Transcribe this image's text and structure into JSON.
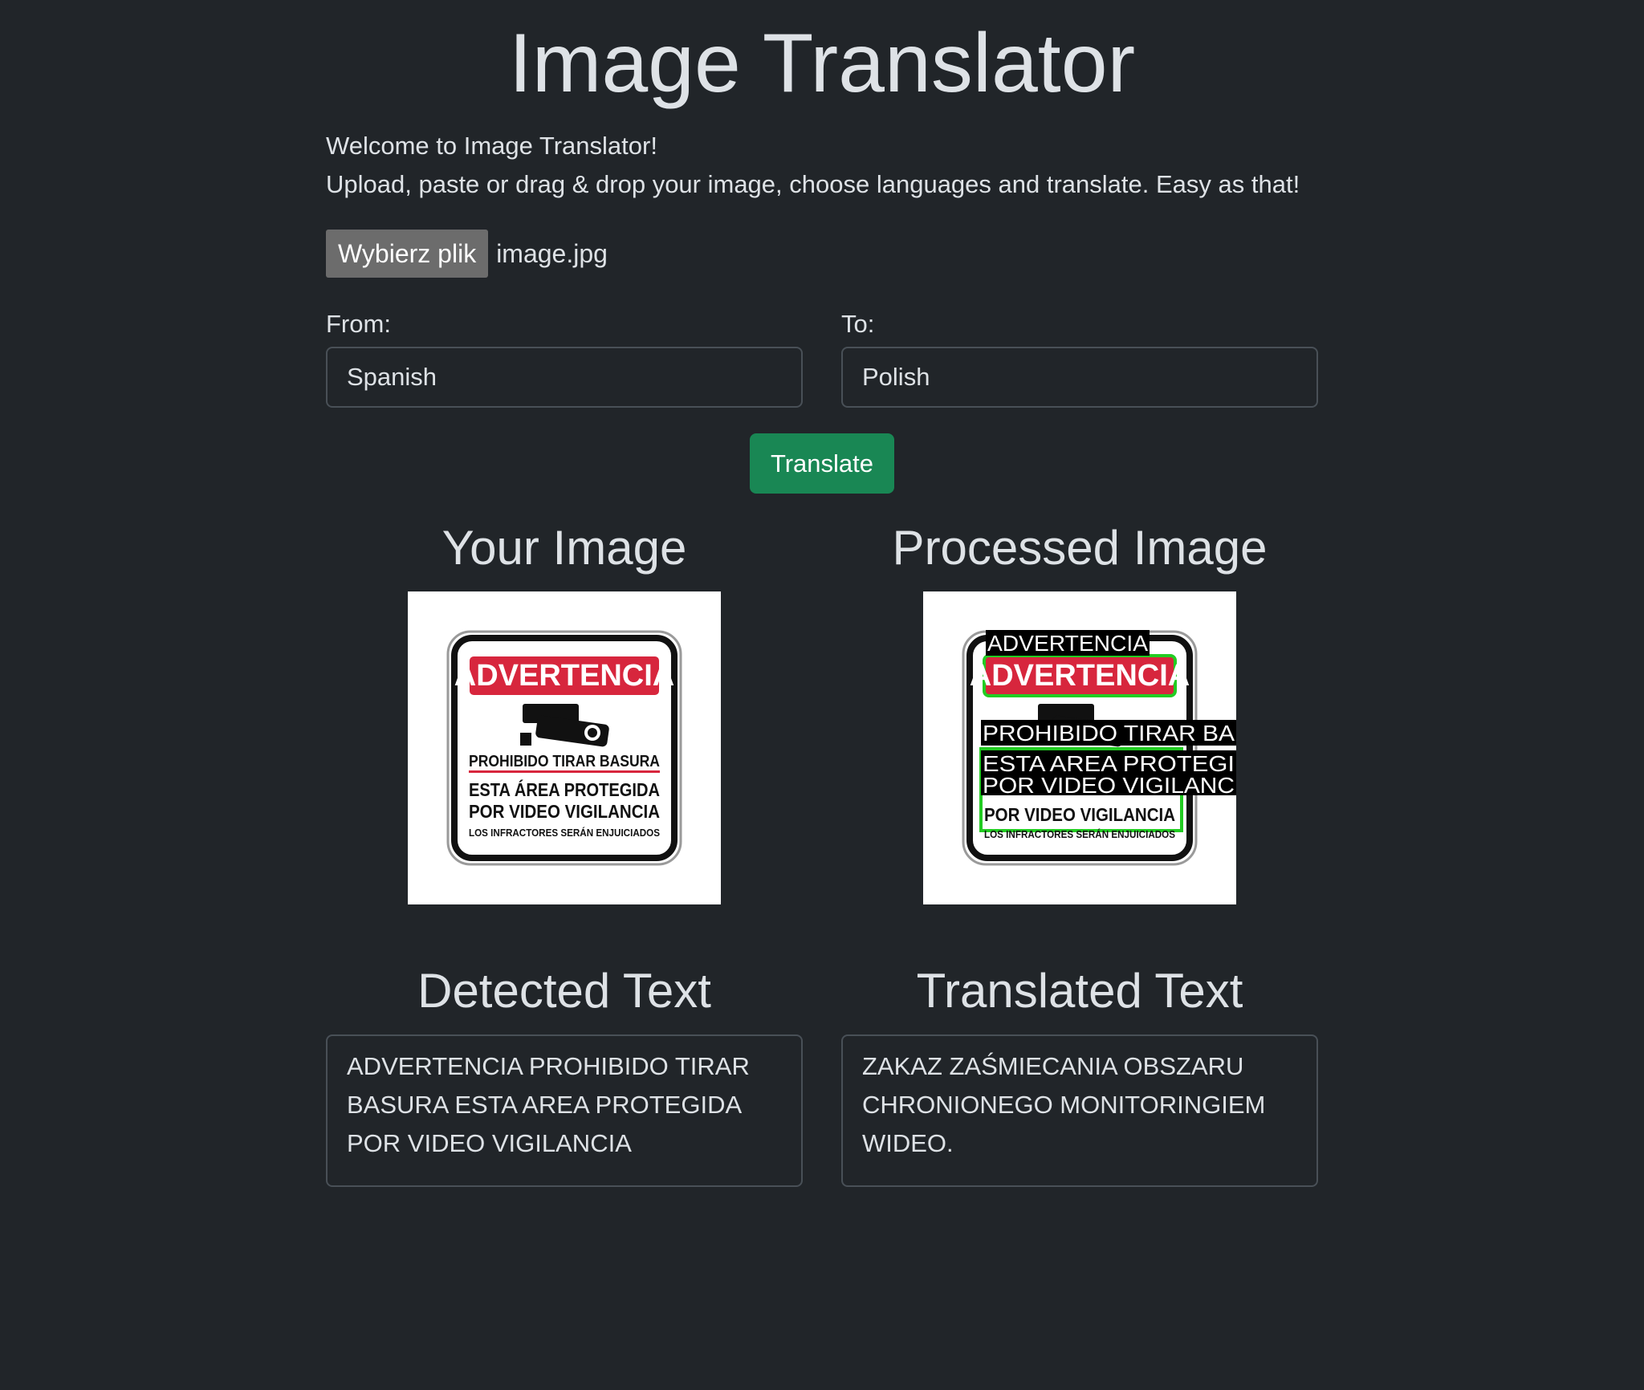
{
  "app": {
    "title": "Image Translator"
  },
  "intro": {
    "welcome": "Welcome to Image Translator!",
    "instructions": "Upload, paste or drag & drop your image, choose languages and translate. Easy as that!"
  },
  "file": {
    "button_label": "Wybierz plik",
    "file_name": "image.jpg"
  },
  "languages": {
    "from_label": "From:",
    "from_value": "Spanish",
    "to_label": "To:",
    "to_value": "Polish"
  },
  "translate_label": "Translate",
  "images": {
    "original_title": "Your Image",
    "processed_title": "Processed Image",
    "sign": {
      "header": "ADVERTENCIA",
      "line1": "PROHIBIDO TIRAR BASURA",
      "line2": "ESTA ÁREA PROTEGIDA",
      "line3": "POR VIDEO VIGILANCIA",
      "line4": "LOS INFRACTORES SERÁN ENJUICIADOS"
    },
    "overlays": {
      "o1": "ADVERTENCIA",
      "o2": "PROHIBIDO TIRAR BA",
      "o3": "ESTA AREA PROTEGI",
      "o4": "POR VIDEO VIGILANC"
    }
  },
  "detected": {
    "title": "Detected Text",
    "text": "ADVERTENCIA PROHIBIDO TIRAR BASURA ESTA AREA PROTEGIDA POR VIDEO VIGILANCIA"
  },
  "translated": {
    "title": "Translated Text",
    "text": "ZAKAZ ZAŚMIECANIA OBSZARU CHRONIONEGO MONITORINGIEM WIDEO."
  },
  "colors": {
    "background": "#212529",
    "text": "#dee2e6",
    "accent_green": "#198754",
    "sign_red": "#d7263d",
    "detection_green": "#22cc22"
  }
}
